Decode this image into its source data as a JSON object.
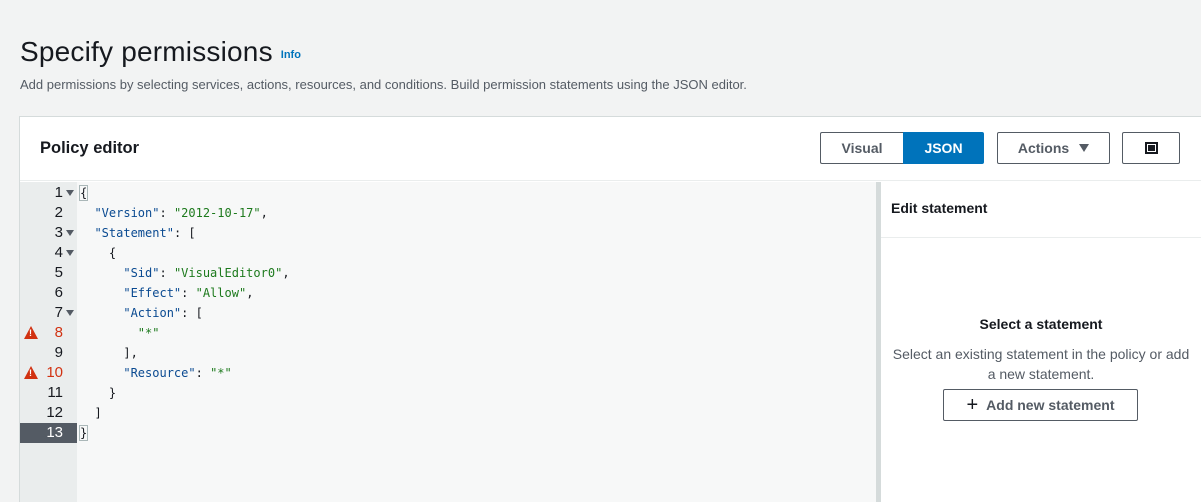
{
  "page": {
    "title": "Specify permissions",
    "info_link": "Info",
    "description": "Add permissions by selecting services, actions, resources, and conditions. Build permission statements using the JSON editor."
  },
  "editor": {
    "title": "Policy editor",
    "mode_visual": "Visual",
    "mode_json": "JSON",
    "selected_mode": "JSON",
    "actions_label": "Actions",
    "fullscreen_icon": "fullscreen-icon",
    "lines": [
      {
        "num": "1",
        "text": "{"
      },
      {
        "num": "2",
        "text": "  \"Version\": \"2012-10-17\","
      },
      {
        "num": "3",
        "text": "  \"Statement\": ["
      },
      {
        "num": "4",
        "text": "    {"
      },
      {
        "num": "5",
        "text": "      \"Sid\": \"VisualEditor0\","
      },
      {
        "num": "6",
        "text": "      \"Effect\": \"Allow\","
      },
      {
        "num": "7",
        "text": "      \"Action\": ["
      },
      {
        "num": "8",
        "text": "        \"*\""
      },
      {
        "num": "9",
        "text": "      ],"
      },
      {
        "num": "10",
        "text": "      \"Resource\": \"*\""
      },
      {
        "num": "11",
        "text": "    }"
      },
      {
        "num": "12",
        "text": "  ]"
      },
      {
        "num": "13",
        "text": "}"
      }
    ],
    "warning_lines": [
      "8",
      "10"
    ],
    "active_line": "13",
    "warning_color": "#d13212",
    "accent_color": "#0073bb"
  },
  "side_panel": {
    "title": "Edit statement",
    "empty_heading": "Select a statement",
    "empty_text": "Select an existing statement in the policy or add a new statement.",
    "add_button_label": "Add new statement",
    "add_icon": "plus-icon"
  }
}
